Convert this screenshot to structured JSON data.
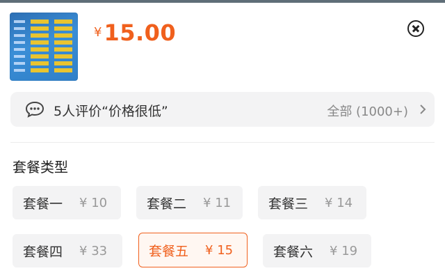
{
  "product": {
    "currency": "¥",
    "price": "15.00",
    "thumbnail_icon": "sim-card-plans-image"
  },
  "review": {
    "text": "5人评价“价格很低”",
    "all_label": "全部 (1000+)"
  },
  "section": {
    "title": "套餐类型"
  },
  "packages": [
    {
      "name": "套餐一",
      "price": "¥ 10",
      "selected": false
    },
    {
      "name": "套餐二",
      "price": "¥ 11",
      "selected": false
    },
    {
      "name": "套餐三",
      "price": "¥ 14",
      "selected": false
    },
    {
      "name": "套餐四",
      "price": "¥ 33",
      "selected": false
    },
    {
      "name": "套餐五",
      "price": "¥ 15",
      "selected": true
    },
    {
      "name": "套餐六",
      "price": "¥ 19",
      "selected": false
    }
  ],
  "colors": {
    "accent": "#f0601d",
    "chip_background": "#f3f3f4"
  }
}
